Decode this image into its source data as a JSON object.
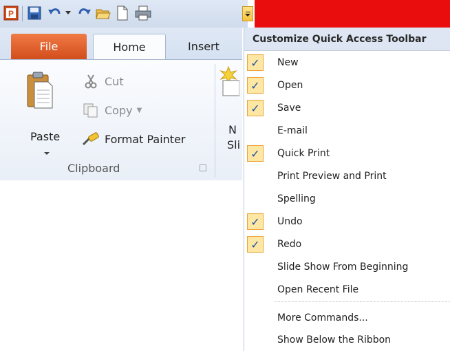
{
  "tabs": {
    "file": "File",
    "home": "Home",
    "insert": "Insert"
  },
  "ribbon": {
    "paste": "Paste",
    "cut": "Cut",
    "copy": "Copy",
    "format_painter": "Format Painter",
    "clipboard_group": "Clipboard",
    "new_slide_line1": "N",
    "new_slide_line2": "Sli"
  },
  "menu": {
    "title": "Customize Quick Access Toolbar",
    "items": [
      {
        "label": "New",
        "checked": true
      },
      {
        "label": "Open",
        "checked": true
      },
      {
        "label": "Save",
        "checked": true
      },
      {
        "label": "E-mail",
        "checked": false
      },
      {
        "label": "Quick Print",
        "checked": true
      },
      {
        "label": "Print Preview and Print",
        "checked": false
      },
      {
        "label": "Spelling",
        "checked": false
      },
      {
        "label": "Undo",
        "checked": true
      },
      {
        "label": "Redo",
        "checked": true
      },
      {
        "label": "Slide Show From Beginning",
        "checked": false
      },
      {
        "label": "Open Recent File",
        "checked": false
      }
    ],
    "more_commands": "More Commands...",
    "show_below": "Show Below the Ribbon",
    "check_glyph": "✓"
  },
  "icons": {
    "app": "powerpoint-icon",
    "save": "save-icon",
    "undo": "undo-icon",
    "redo": "redo-icon",
    "open": "open-folder-icon",
    "new": "new-document-icon",
    "print": "quick-print-icon"
  },
  "colors": {
    "accent_red": "#e90d0d",
    "file_tab": "#d24e1c",
    "check_bg": "#fde7a3"
  }
}
